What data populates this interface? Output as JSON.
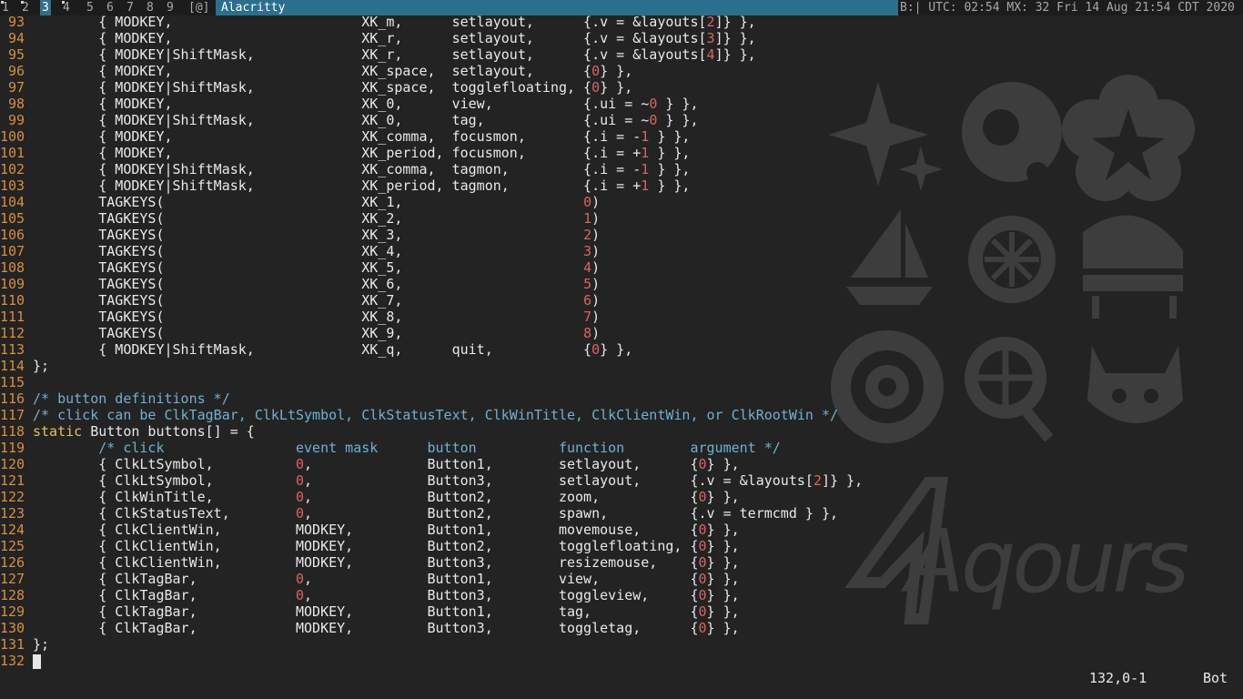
{
  "topbar": {
    "tags": [
      "1",
      "2",
      "3",
      "4",
      "5",
      "6",
      "7",
      "8",
      "9"
    ],
    "active_tag": "3",
    "layout_symbol": "[@]",
    "window_title": "Alacritty",
    "status_text": "B:| UTC: 02:54 MX: 32 Fri 14 Aug 21:54 CDT 2020"
  },
  "editor": {
    "lines": [
      {
        "n": "93",
        "t": "        { MODKEY,                       XK_m,      setlayout,      {.v = &layouts[2]} },"
      },
      {
        "n": "94",
        "t": "        { MODKEY,                       XK_r,      setlayout,      {.v = &layouts[3]} },"
      },
      {
        "n": "95",
        "t": "        { MODKEY|ShiftMask,             XK_r,      setlayout,      {.v = &layouts[4]} },"
      },
      {
        "n": "96",
        "t": "        { MODKEY,                       XK_space,  setlayout,      {0} },"
      },
      {
        "n": "97",
        "t": "        { MODKEY|ShiftMask,             XK_space,  togglefloating, {0} },"
      },
      {
        "n": "98",
        "t": "        { MODKEY,                       XK_0,      view,           {.ui = ~0 } },"
      },
      {
        "n": "99",
        "t": "        { MODKEY|ShiftMask,             XK_0,      tag,            {.ui = ~0 } },"
      },
      {
        "n": "100",
        "t": "        { MODKEY,                       XK_comma,  focusmon,       {.i = -1 } },"
      },
      {
        "n": "101",
        "t": "        { MODKEY,                       XK_period, focusmon,       {.i = +1 } },"
      },
      {
        "n": "102",
        "t": "        { MODKEY|ShiftMask,             XK_comma,  tagmon,         {.i = -1 } },"
      },
      {
        "n": "103",
        "t": "        { MODKEY|ShiftMask,             XK_period, tagmon,         {.i = +1 } },"
      },
      {
        "n": "104",
        "t": "        TAGKEYS(                        XK_1,                      0)"
      },
      {
        "n": "105",
        "t": "        TAGKEYS(                        XK_2,                      1)"
      },
      {
        "n": "106",
        "t": "        TAGKEYS(                        XK_3,                      2)"
      },
      {
        "n": "107",
        "t": "        TAGKEYS(                        XK_4,                      3)"
      },
      {
        "n": "108",
        "t": "        TAGKEYS(                        XK_5,                      4)"
      },
      {
        "n": "109",
        "t": "        TAGKEYS(                        XK_6,                      5)"
      },
      {
        "n": "110",
        "t": "        TAGKEYS(                        XK_7,                      6)"
      },
      {
        "n": "111",
        "t": "        TAGKEYS(                        XK_8,                      7)"
      },
      {
        "n": "112",
        "t": "        TAGKEYS(                        XK_9,                      8)"
      },
      {
        "n": "113",
        "t": "        { MODKEY|ShiftMask,             XK_q,      quit,           {0} },"
      },
      {
        "n": "114",
        "t": "};"
      },
      {
        "n": "115",
        "t": ""
      },
      {
        "n": "116",
        "t": "/* button definitions */"
      },
      {
        "n": "117",
        "t": "/* click can be ClkTagBar, ClkLtSymbol, ClkStatusText, ClkWinTitle, ClkClientWin, or ClkRootWin */"
      },
      {
        "n": "118",
        "t": "static Button buttons[] = {"
      },
      {
        "n": "119",
        "t": "        /* click                event mask      button          function        argument */"
      },
      {
        "n": "120",
        "t": "        { ClkLtSymbol,          0,              Button1,        setlayout,      {0} },"
      },
      {
        "n": "121",
        "t": "        { ClkLtSymbol,          0,              Button3,        setlayout,      {.v = &layouts[2]} },"
      },
      {
        "n": "122",
        "t": "        { ClkWinTitle,          0,              Button2,        zoom,           {0} },"
      },
      {
        "n": "123",
        "t": "        { ClkStatusText,        0,              Button2,        spawn,          {.v = termcmd } },"
      },
      {
        "n": "124",
        "t": "        { ClkClientWin,         MODKEY,         Button1,        movemouse,      {0} },"
      },
      {
        "n": "125",
        "t": "        { ClkClientWin,         MODKEY,         Button2,        togglefloating, {0} },"
      },
      {
        "n": "126",
        "t": "        { ClkClientWin,         MODKEY,         Button3,        resizemouse,    {0} },"
      },
      {
        "n": "127",
        "t": "        { ClkTagBar,            0,              Button1,        view,           {0} },"
      },
      {
        "n": "128",
        "t": "        { ClkTagBar,            0,              Button3,        toggleview,     {0} },"
      },
      {
        "n": "129",
        "t": "        { ClkTagBar,            MODKEY,         Button1,        tag,            {0} },"
      },
      {
        "n": "130",
        "t": "        { ClkTagBar,            MODKEY,         Button3,        toggletag,      {0} },"
      },
      {
        "n": "131",
        "t": "};"
      },
      {
        "n": "132",
        "t": ""
      }
    ],
    "cursor_line": "132",
    "ruler": "132,0-1",
    "scroll_position": "Bot"
  },
  "wallpaper": {
    "logo_text": "Aqours",
    "icons": [
      "sparkle-icon",
      "dolphin-icon",
      "flower-icon",
      "sailboat-icon",
      "orange-slice-icon",
      "piano-icon",
      "swirl-flower-icon",
      "candy-icon",
      "devil-icon"
    ]
  },
  "colors": {
    "background": "#232323",
    "line_number": "#d98e3a",
    "number_literal": "#e06060",
    "comment": "#6fb0d0",
    "keyword": "#e0c060",
    "title_bar": "#2a6f8e"
  }
}
